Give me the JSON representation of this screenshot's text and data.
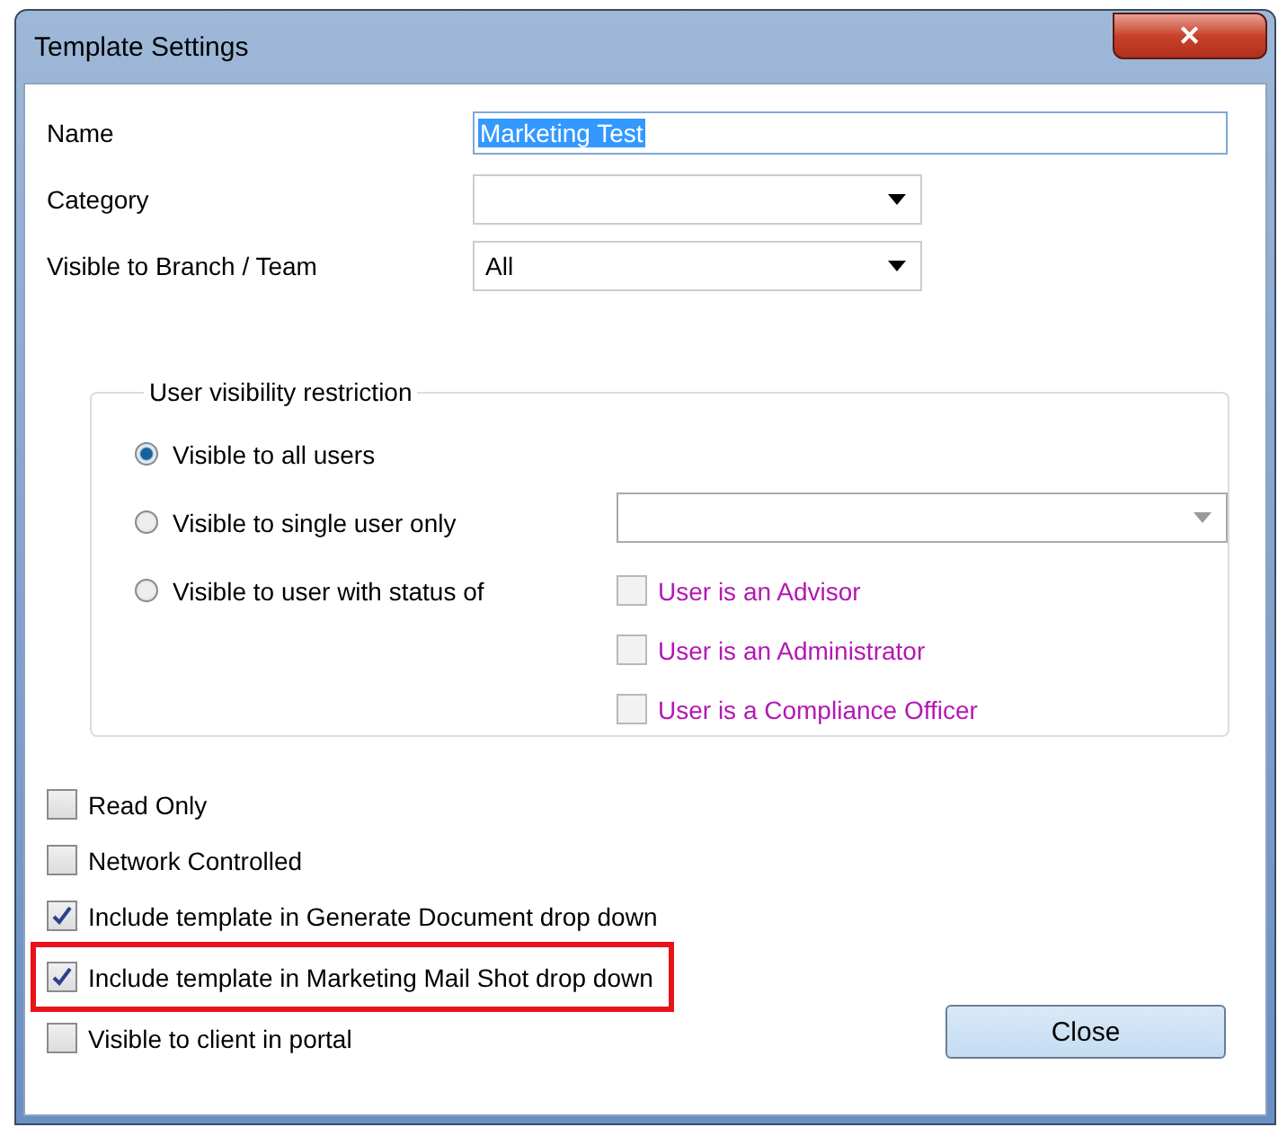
{
  "window": {
    "title": "Template Settings",
    "close": "✕"
  },
  "fields": [
    {
      "kind": "text",
      "label": "Name",
      "value": "Marketing Test",
      "selected_text": true
    },
    {
      "kind": "combo",
      "label": "Category"
    },
    {
      "kind": "combo",
      "label": "Visible to Branch / Team",
      "value": "All"
    }
  ],
  "group": {
    "title": "User visibility restriction",
    "radios": [
      {
        "label": "Visible to all users",
        "selected": true
      },
      {
        "label": "Visible to single user only",
        "selected": false
      },
      {
        "label": "Visible to user with status of",
        "selected": false
      }
    ],
    "user_combo": {
      "disabled": true
    },
    "statuses": [
      {
        "label": "User is an Advisor",
        "checked": false,
        "disabled": true
      },
      {
        "label": "User is an Administrator",
        "checked": false,
        "disabled": true
      },
      {
        "label": "User is a Compliance Officer",
        "checked": false,
        "disabled": true
      }
    ]
  },
  "options": [
    {
      "label": "Read Only",
      "checked": false,
      "highlighted": false
    },
    {
      "label": "Network Controlled",
      "checked": false,
      "highlighted": false
    },
    {
      "label": "Include template in Generate Document drop down",
      "checked": true,
      "highlighted": false
    },
    {
      "label": "Include template in Marketing Mail Shot drop down",
      "checked": true,
      "highlighted": true
    },
    {
      "label": "Visible to client in portal",
      "checked": false,
      "highlighted": false
    }
  ],
  "buttons": [
    "Close"
  ]
}
